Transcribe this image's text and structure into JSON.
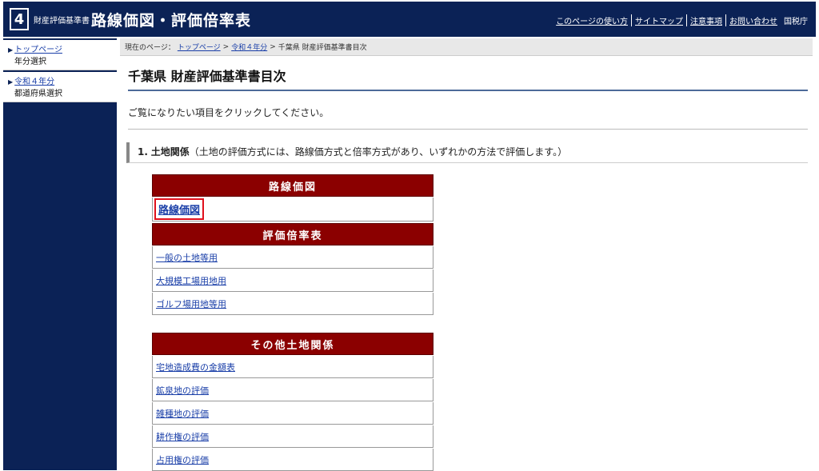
{
  "header": {
    "badge": "4",
    "subtitle": "財産評価基準書",
    "title": "路線価図・評価倍率表",
    "links": [
      "このページの使い方",
      "サイトマップ",
      "注意事項",
      "お問い合わせ"
    ],
    "agency": "国税庁"
  },
  "sidebar": {
    "items": [
      {
        "label": "トップページ",
        "sub": "年分選択"
      },
      {
        "label": "令和４年分",
        "sub": "都道府県選択"
      }
    ]
  },
  "breadcrumb": {
    "prefix": "現在のページ：",
    "items": [
      "トップページ",
      "令和４年分"
    ],
    "current": "千葉県 財産評価基準書目次",
    "separator": ">"
  },
  "page_title": "千葉県 財産評価基準書目次",
  "intro": "ご覧になりたい項目をクリックしてください。",
  "section": {
    "number": "1.",
    "title": "土地関係",
    "note": "（土地の評価方式には、路線価方式と倍率方式があり、いずれかの方法で評価します。）"
  },
  "blocks": {
    "rosenka": {
      "head": "路線価図",
      "items": [
        "路線価図"
      ]
    },
    "bairitsu": {
      "head": "評価倍率表",
      "items": [
        "一般の土地等用",
        "大規模工場用地用",
        "ゴルフ場用地等用"
      ]
    },
    "other": {
      "head": "その他土地関係",
      "items": [
        "宅地造成費の金額表",
        "鉱泉地の評価",
        "雑種地の評価",
        "耕作権の評価",
        "占用権の評価"
      ]
    }
  },
  "colors": {
    "header_bg": "#0b2256",
    "block_head": "#8b0000",
    "link": "#1a3fa8",
    "highlight": "#e0101c"
  }
}
